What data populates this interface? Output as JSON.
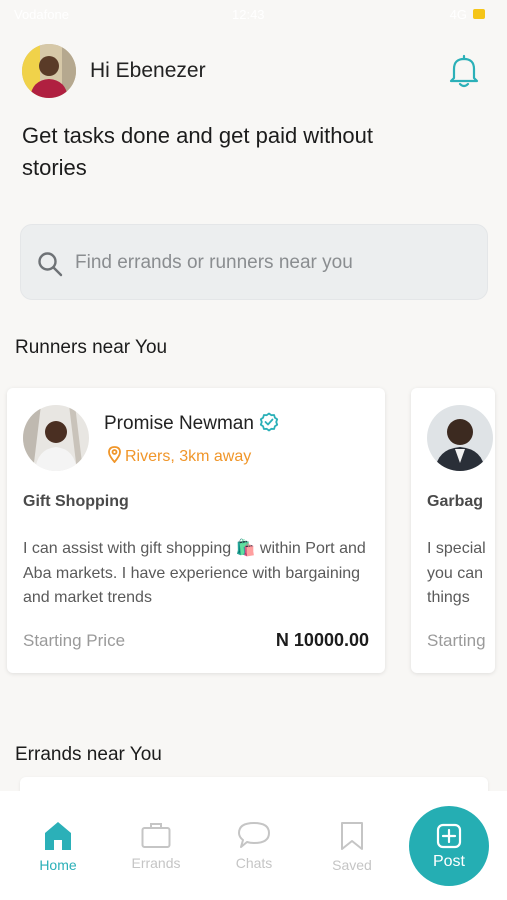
{
  "status_bar": {
    "carrier": "Vodafone",
    "time": "12:43",
    "signal": "4G"
  },
  "header": {
    "greeting": "Hi Ebenezer"
  },
  "tagline": "Get tasks done and get paid without stories",
  "search": {
    "placeholder": "Find errands or runners near you"
  },
  "runners_section": {
    "title": "Runners near You"
  },
  "runners": [
    {
      "name": "Promise Newman",
      "verified": true,
      "location": "Rivers, 3km away",
      "service": "Gift Shopping",
      "description": "I can assist with gift shopping 🛍️ within Port and Aba markets. I have experience with bargaining and market trends",
      "price_label": "Starting Price",
      "price": "N 10000.00"
    },
    {
      "service": "Garbag",
      "description_lines": [
        "I special",
        "you can",
        "things"
      ],
      "price_label": "Starting"
    }
  ],
  "errands_section": {
    "title": "Errands near You"
  },
  "tabbar": {
    "items": [
      {
        "label": "Home",
        "icon": "home-icon",
        "active": true
      },
      {
        "label": "Errands",
        "icon": "briefcase-icon",
        "active": false
      },
      {
        "label": "Chats",
        "icon": "chat-icon",
        "active": false
      },
      {
        "label": "Saved",
        "icon": "bookmark-icon",
        "active": false
      }
    ],
    "post_label": "Post"
  },
  "colors": {
    "accent": "#25aeb3",
    "location": "#f0962a",
    "background": "#f8f7f5"
  }
}
